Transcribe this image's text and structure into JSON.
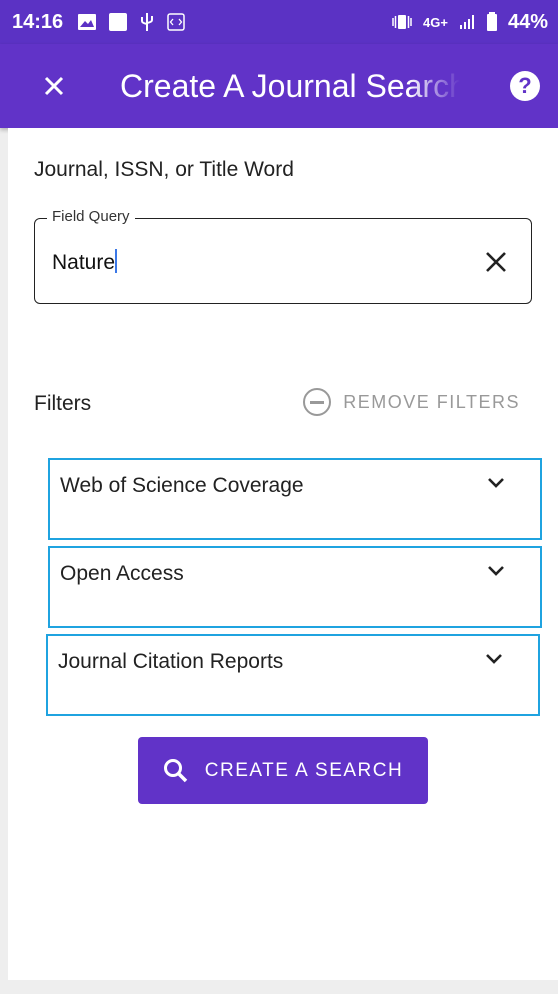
{
  "status_bar": {
    "time": "14:16",
    "network": "4G+",
    "battery": "44%"
  },
  "app_bar": {
    "title": "Create A Journal Search",
    "help_icon": "question-circle-icon",
    "close_icon": "close-icon"
  },
  "form": {
    "field_label": "Journal, ISSN, or Title Word",
    "input_legend": "Field Query",
    "input_value": "Nature",
    "filters_label": "Filters",
    "remove_filters": "REMOVE FILTERS",
    "filters": [
      {
        "label": "Web of Science Coverage"
      },
      {
        "label": "Open Access"
      },
      {
        "label": "Journal Citation Reports"
      }
    ],
    "search_button": "CREATE A SEARCH"
  },
  "colors": {
    "primary": "#6133c8",
    "status_bar": "#5b32c4",
    "filter_border": "#1fa3e0",
    "muted": "#999999"
  }
}
